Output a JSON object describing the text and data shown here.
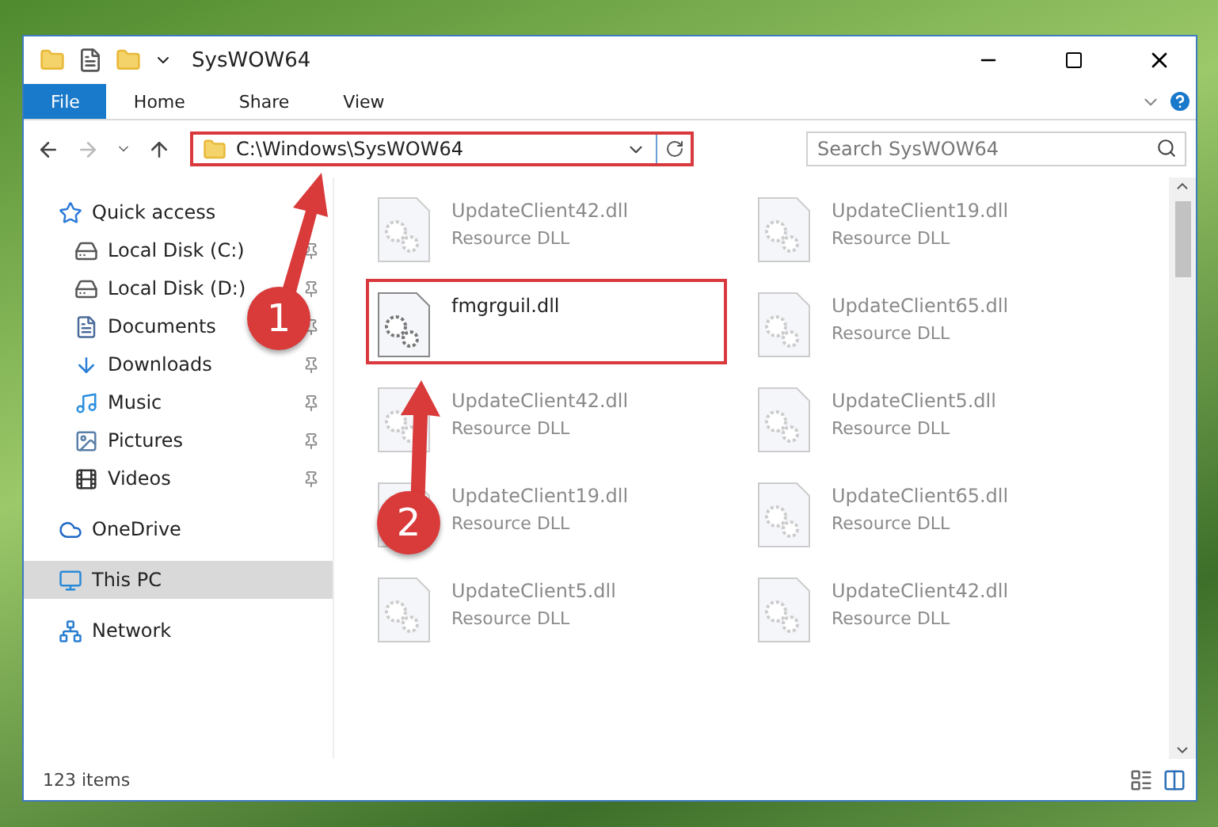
{
  "window": {
    "title": "SysWOW64"
  },
  "ribbon_tabs": [
    {
      "label": "File",
      "kind": "file"
    },
    {
      "label": "Home",
      "kind": "tab"
    },
    {
      "label": "Share",
      "kind": "tab"
    },
    {
      "label": "View",
      "kind": "tab"
    }
  ],
  "address": {
    "path": "C:\\Windows\\SysWOW64",
    "highlighted": true
  },
  "search": {
    "placeholder": "Search SysWOW64"
  },
  "sidebar": {
    "items": [
      {
        "label": "Quick access",
        "kind": "star",
        "selected": false,
        "children": [
          {
            "label": "Local Disk (C:)",
            "kind": "drive",
            "pinned": true,
            "selected": false
          },
          {
            "label": "Local Disk (D:)",
            "kind": "drive",
            "pinned": true,
            "selected": false
          },
          {
            "label": "Documents",
            "kind": "document",
            "pinned": true,
            "selected": false
          },
          {
            "label": "Downloads",
            "kind": "download",
            "pinned": true,
            "selected": false
          },
          {
            "label": "Music",
            "kind": "music",
            "pinned": true,
            "selected": false
          },
          {
            "label": "Pictures",
            "kind": "picture",
            "pinned": true,
            "selected": false
          },
          {
            "label": "Videos",
            "kind": "video",
            "pinned": true,
            "selected": false
          }
        ]
      },
      {
        "label": "OneDrive",
        "kind": "cloud",
        "selected": false
      },
      {
        "label": "This PC",
        "kind": "pc",
        "selected": true
      },
      {
        "label": "Network",
        "kind": "network",
        "selected": false
      }
    ]
  },
  "files": [
    {
      "name": "UpdateClient42.dll",
      "type": "Resource DLL",
      "highlighted": false
    },
    {
      "name": "UpdateClient19.dll",
      "type": "Resource DLL",
      "highlighted": false
    },
    {
      "name": "fmgrguil.dll",
      "highlighted": true
    },
    {
      "name": "UpdateClient65.dll",
      "type": "Resource DLL",
      "highlighted": false
    },
    {
      "name": "UpdateClient42.dll",
      "type": "Resource DLL",
      "highlighted": false
    },
    {
      "name": "UpdateClient5.dll",
      "type": "Resource DLL",
      "highlighted": false
    },
    {
      "name": "UpdateClient19.dll",
      "type": "Resource DLL",
      "highlighted": false
    },
    {
      "name": "UpdateClient65.dll",
      "type": "Resource DLL",
      "highlighted": false
    },
    {
      "name": "UpdateClient5.dll",
      "type": "Resource DLL",
      "highlighted": false
    },
    {
      "name": "UpdateClient42.dll",
      "type": "Resource DLL",
      "highlighted": false
    }
  ],
  "status_bar": {
    "count": "123 items"
  },
  "annotations": [
    {
      "label": "1"
    },
    {
      "label": "2"
    }
  ]
}
